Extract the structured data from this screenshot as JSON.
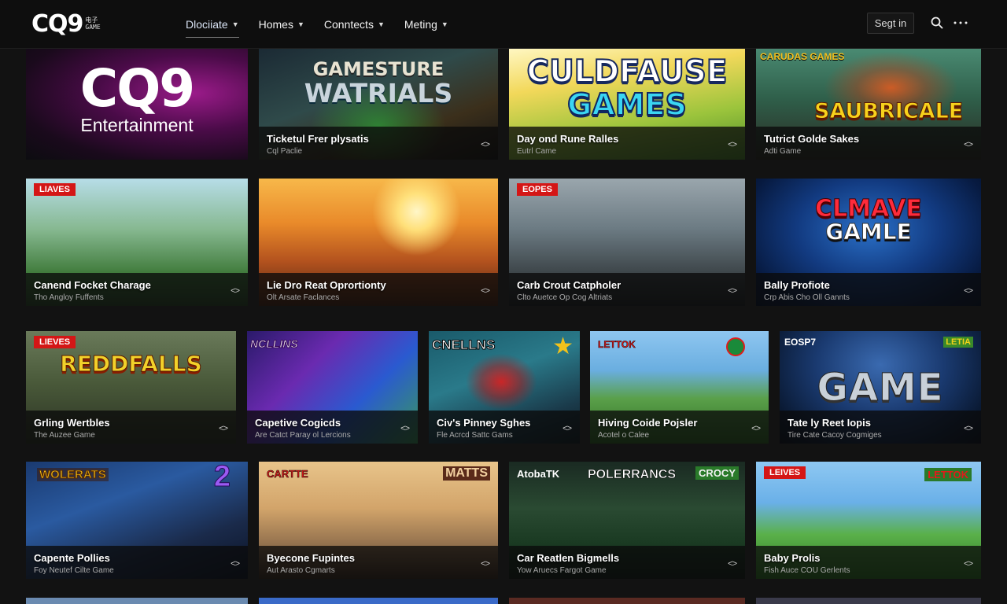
{
  "header": {
    "logo": "CQ9",
    "logo_sub": [
      "电子",
      "GAME"
    ],
    "nav": [
      {
        "label": "Dlociiate",
        "active": true
      },
      {
        "label": "Homes"
      },
      {
        "label": "Conntects"
      },
      {
        "label": "Meting"
      }
    ],
    "signin": "Segt in",
    "icons": [
      "search-icon",
      "more-icon"
    ]
  },
  "tiles": [
    {
      "id": "cq9-entertainment",
      "art_text": "CQ9",
      "art_sub": "Entertainment"
    },
    {
      "id": "gamesture",
      "art_text": "GAMESTURE",
      "art_sub": "WATRIALS",
      "title": "Ticketul Frer plysatis",
      "sub": "Cql Paclie"
    },
    {
      "id": "culdfause",
      "art_text": "CULDFAUSE",
      "art_sub": "GAMES",
      "title": "Day ond Rune Ralles",
      "sub": "Eutrl Came"
    },
    {
      "id": "saubricale",
      "art_text": "SAUBRICALE",
      "corner": "CARUDAS GAMES",
      "title": "Tutrict Golde Sakes",
      "sub": "Adti Game"
    },
    {
      "id": "canend",
      "badge": "LIAVES",
      "title": "Canend Focket Charage",
      "sub": "Tho Angloy Fuffents"
    },
    {
      "id": "lie-dro",
      "title": "Lie Dro Reat Oprortionty",
      "sub": "Olt Arsate Faclances"
    },
    {
      "id": "carb-crout",
      "badge": "EOPES",
      "title": "Carb Crout Catpholer",
      "sub": "Clto Auetce Op Cog Altriats"
    },
    {
      "id": "bally-profiote",
      "art_text": "CLMAVE",
      "art_sub": "GAMLE",
      "title": "Bally Profiote",
      "sub": "Crp Abis Cho Oll Gannts"
    },
    {
      "id": "redfalls",
      "badge": "LIEVES",
      "art_text": "REDDFALLS",
      "title": "Grling Wertbles",
      "sub": "The Auzee Game"
    },
    {
      "id": "capetive",
      "corner": "NCLLINS",
      "title": "Capetive Cogicds",
      "sub": "Are Catct Paray ol Lercions"
    },
    {
      "id": "civs-pinney",
      "corner": "CNELLNS",
      "title": "Civ's Pinney Sghes",
      "sub": "Fle Acrcd Sattc Gams"
    },
    {
      "id": "hiving-coide",
      "corner": "LETTOK",
      "title": "Hiving Coide Pojsler",
      "sub": "Acotel o Calee"
    },
    {
      "id": "game-tate",
      "corner": "EOSP7",
      "corner2": "LETIA",
      "art_text": "GAME",
      "title": "Tate ly Reet Iopis",
      "sub": "Tire Cate Cacoy Cogmiges"
    },
    {
      "id": "wolerats",
      "corner": "WOLERATS",
      "corner2": "2",
      "title": "Capente Pollies",
      "sub": "Foy Neutef Cilte Game"
    },
    {
      "id": "byecone",
      "corner": "CARTTE",
      "corner2": "MATTS",
      "title": "Byecone Fupintes",
      "sub": "Aut Arasto Cgmarts"
    },
    {
      "id": "car-reatlen",
      "corner": "AtobaTK",
      "art_text": "POLERRANCS",
      "corner2": "CROCY",
      "title": "Car Reatlen Bigmells",
      "sub": "Yow Aruecs Fargot Game"
    },
    {
      "id": "baby-prolls",
      "badge": "LEIVES",
      "corner2": "LETTOK",
      "title": "Baby Prolis",
      "sub": "Fish Auce COU Gerlents"
    }
  ],
  "colors": {
    "accent_red": "#d41616",
    "nav_active": "#d9e4f5",
    "header_bg": "#0e0e0e",
    "page_bg": "#121212"
  }
}
